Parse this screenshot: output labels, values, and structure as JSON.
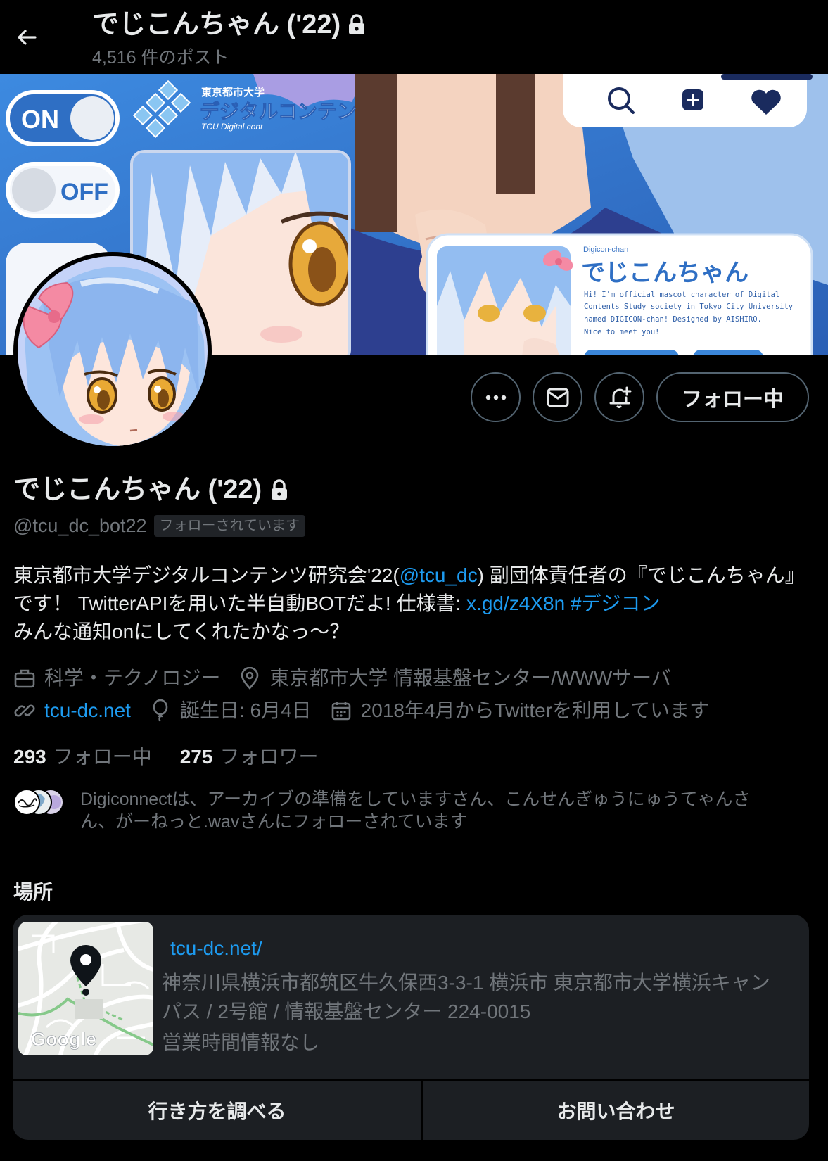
{
  "header": {
    "title": "でじこんちゃん ('22)",
    "post_count": "4,516 件のポスト",
    "back_icon": "arrow-left-icon",
    "lock_icon": "lock-icon"
  },
  "banner": {
    "on_label": "ON",
    "off_label": "OFF",
    "logo_line1": "東京都市大学",
    "logo_line2": "デジタルコンテン",
    "logo_line3": "TCU Digital cont",
    "card_subtitle": "Digicon-chan",
    "card_title": "でじこんちゃん",
    "card_lines": [
      "Hi! I'm official mascot character of Digital",
      "Contents Study society in Tokyo City University",
      "named DIGICON-chan! Designed by AISHIRO.",
      "Nice to meet you!"
    ]
  },
  "actions": {
    "more_icon": "more-icon",
    "message_icon": "mail-icon",
    "notify_icon": "bell-plus-icon",
    "follow_label": "フォロー中"
  },
  "profile": {
    "name": "でじこんちゃん ('22)",
    "handle": "@tcu_dc_bot22",
    "follows_you": "フォローされています",
    "bio": [
      {
        "type": "text",
        "text": "東京都市大学デジタルコンテンツ研究会'22("
      },
      {
        "type": "mention",
        "text": "@tcu_dc"
      },
      {
        "type": "text",
        "text": ") 副団体責任者の『でじこんちゃん』です！ TwitterAPIを用いた半自動BOTだよ! 仕様書: "
      },
      {
        "type": "link",
        "text": "x.gd/z4X8n"
      },
      {
        "type": "text",
        "text": " "
      },
      {
        "type": "hashtag",
        "text": "#デジコン"
      },
      {
        "type": "text",
        "text": "\nみんな通知onにしてくれたかなっ～？"
      }
    ]
  },
  "meta": {
    "category": "科学・テクノロジー",
    "location": "東京都市大学 情報基盤センター/WWWサーバ",
    "website": "tcu-dc.net",
    "birthday": "誕生日: 6月4日",
    "joined": "2018年4月からTwitterを利用しています"
  },
  "stats": {
    "following_count": "293",
    "following_label": "フォロー中",
    "followers_count": "275",
    "followers_label": "フォロワー"
  },
  "followers_you_know": "Digiconnectは、アーカイブの準備をしていますさん、こんせんぎゅうにゅうてゃんさん、がーねっと.wavさんにフォローされています",
  "location_card": {
    "heading": "場所",
    "url": "tcu-dc.net/",
    "address": "神奈川県横浜市都筑区牛久保西3-3-1 横浜市 東京都市大学横浜キャンパス / 2号館 / 情報基盤センター 224-0015",
    "hours": "営業時間情報なし",
    "map_watermark": "Google",
    "directions_label": "行き方を調べる",
    "contact_label": "お問い合わせ"
  },
  "colors": {
    "background": "#000000",
    "text": "#e7e9ea",
    "secondary_text": "#71767b",
    "accent": "#1d9bf0",
    "card": "#1c1f23",
    "button_border": "#536471"
  }
}
